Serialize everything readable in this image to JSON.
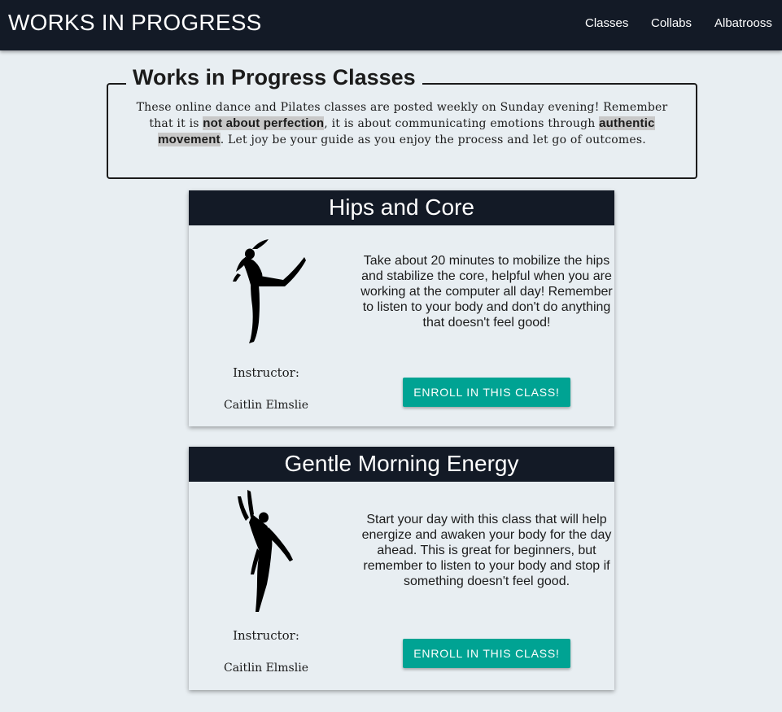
{
  "nav": {
    "brand": "WORKS IN PROGRESS",
    "links": [
      "Classes",
      "Collabs",
      "Albatrooss"
    ]
  },
  "intro": {
    "title": "Works in Progress Classes",
    "text_1": "These online dance and Pilates classes are posted weekly on Sunday evening! Remember that it is ",
    "highlight_1": "not about perfection",
    "text_2": ", it is about communicating emotions through ",
    "highlight_2": "authentic movement",
    "text_3": ". Let joy be your guide as you enjoy the process and let go of outcomes."
  },
  "classes": [
    {
      "title": "Hips and Core",
      "description": "Take about 20 minutes to mobilize the hips and stabilize the core, helpful when you are working at the computer all day! Remember to listen to your body and don't do anything that doesn't feel good!",
      "instructor_label": "Instructor:",
      "instructor_name": "Caitlin Elmslie",
      "button": "Enroll in this class!",
      "image_icon": "dancer-arabesque-silhouette"
    },
    {
      "title": "Gentle Morning Energy",
      "description": "Start your day with this class that will help energize and awaken your body for the day ahead. This is great for beginners, but remember to listen to your body and stop if something doesn't feel good.",
      "instructor_label": "Instructor:",
      "instructor_name": "Caitlin Elmslie",
      "button": "Enroll in this class!",
      "image_icon": "dancer-leg-extension-silhouette"
    }
  ],
  "colors": {
    "navbar": "#131a26",
    "background": "#e8eef2",
    "button": "#00a393",
    "highlight": "#c8c8c8"
  }
}
